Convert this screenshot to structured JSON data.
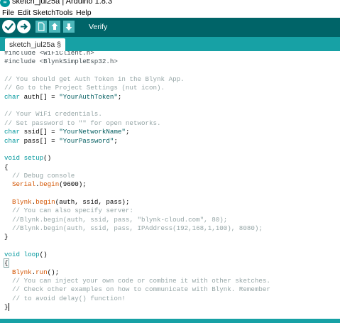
{
  "window": {
    "title": "sketch_jul25a | Arduino 1.8.3",
    "app_icon": "arduino-logo-icon",
    "app_icon_text": "∞"
  },
  "menu": [
    "File",
    "Edit",
    "Sketch",
    "Tools",
    "Help"
  ],
  "toolbar": {
    "verify_label": "Verify",
    "icons": [
      "verify-check-icon",
      "upload-arrow-icon",
      "new-sketch-icon",
      "open-sketch-icon",
      "save-sketch-icon"
    ],
    "colors": {
      "background": "#006468",
      "button": "#ffffff",
      "file_button": "#4db7bb"
    }
  },
  "tabs": [
    {
      "label": "sketch_jul25a §",
      "active": true
    }
  ],
  "editor": {
    "colors": {
      "comment": "#95a5a6",
      "keyword": "#00979c",
      "string": "#005c5f",
      "function": "#d35400",
      "preprocessor": "#434f54"
    },
    "lines": [
      [
        [
          "#include <WiFiClient.h>",
          "pp"
        ]
      ],
      [
        [
          "#include <BlynkSimpleEsp32.h>",
          "pp"
        ]
      ],
      [],
      [
        [
          "// You should get Auth Token in the Blynk App.",
          "com"
        ]
      ],
      [
        [
          "// Go to the Project Settings (nut icon).",
          "com"
        ]
      ],
      [
        [
          "char",
          "kw"
        ],
        [
          " auth[] = ",
          ""
        ],
        [
          "\"YourAuthToken\"",
          "str"
        ],
        [
          ";",
          ""
        ]
      ],
      [],
      [
        [
          "// Your WiFi credentials.",
          "com"
        ]
      ],
      [
        [
          "// Set password to \"\" for open networks.",
          "com"
        ]
      ],
      [
        [
          "char",
          "kw"
        ],
        [
          " ssid[] = ",
          ""
        ],
        [
          "\"YourNetworkName\"",
          "str"
        ],
        [
          ";",
          ""
        ]
      ],
      [
        [
          "char",
          "kw"
        ],
        [
          " pass[] = ",
          ""
        ],
        [
          "\"YourPassword\"",
          "str"
        ],
        [
          ";",
          ""
        ]
      ],
      [],
      [
        [
          "void",
          "kw"
        ],
        [
          " ",
          ""
        ],
        [
          "setup",
          "kw"
        ],
        [
          "()",
          ""
        ]
      ],
      [
        [
          "{",
          ""
        ]
      ],
      [
        [
          "  // Debug console",
          "com"
        ]
      ],
      [
        [
          "  ",
          ""
        ],
        [
          "Serial",
          "fn"
        ],
        [
          ".",
          ""
        ],
        [
          "begin",
          "fn"
        ],
        [
          "(9600);",
          ""
        ]
      ],
      [],
      [
        [
          "  ",
          ""
        ],
        [
          "Blynk",
          "fn"
        ],
        [
          ".",
          ""
        ],
        [
          "begin",
          "fn"
        ],
        [
          "(auth, ssid, pass);",
          ""
        ]
      ],
      [
        [
          "  // You can also specify server:",
          "com"
        ]
      ],
      [
        [
          "  //Blynk.begin(auth, ssid, pass, \"blynk-cloud.com\", 80);",
          "com"
        ]
      ],
      [
        [
          "  //Blynk.begin(auth, ssid, pass, IPAddress(192,168,1,100), 8080);",
          "com"
        ]
      ],
      [
        [
          "}",
          ""
        ]
      ],
      [],
      [
        [
          "void",
          "kw"
        ],
        [
          " ",
          ""
        ],
        [
          "loop",
          "kw"
        ],
        [
          "()",
          ""
        ]
      ],
      [
        [
          "{",
          "caret"
        ]
      ],
      [
        [
          "  ",
          ""
        ],
        [
          "Blynk",
          "fn"
        ],
        [
          ".",
          ""
        ],
        [
          "run",
          "fn"
        ],
        [
          "();",
          ""
        ]
      ],
      [
        [
          "  // You can inject your own code or combine it with other sketches.",
          "com"
        ]
      ],
      [
        [
          "  // Check other examples on how to communicate with Blynk. Remember",
          "com"
        ]
      ],
      [
        [
          "  // to avoid delay() function!",
          "com"
        ]
      ],
      [
        [
          "}",
          "cursor"
        ]
      ]
    ]
  }
}
